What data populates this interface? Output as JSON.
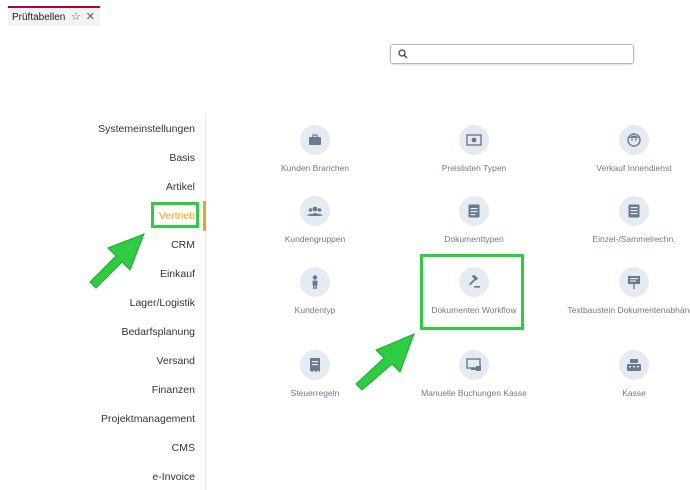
{
  "tab": {
    "title": "Prüftabellen",
    "star_icon": "star-icon",
    "close_icon": "close-icon"
  },
  "search": {
    "value": "",
    "placeholder": "",
    "icon": "search-icon"
  },
  "sidebar": {
    "items": [
      {
        "label": "Systemeinstellungen",
        "active": false
      },
      {
        "label": "Basis",
        "active": false
      },
      {
        "label": "Artikel",
        "active": false
      },
      {
        "label": "Vertrieb",
        "active": true
      },
      {
        "label": "CRM",
        "active": false
      },
      {
        "label": "Einkauf",
        "active": false
      },
      {
        "label": "Lager/Logistik",
        "active": false
      },
      {
        "label": "Bedarfsplanung",
        "active": false
      },
      {
        "label": "Versand",
        "active": false
      },
      {
        "label": "Finanzen",
        "active": false
      },
      {
        "label": "Projektmanagement",
        "active": false
      },
      {
        "label": "CMS",
        "active": false
      },
      {
        "label": "e-Invoice",
        "active": false
      }
    ]
  },
  "tiles": [
    {
      "label": "Kunden Branchen",
      "icon": "briefcase-icon"
    },
    {
      "label": "Preislisten Typen",
      "icon": "money-icon"
    },
    {
      "label": "Verkauf Innendienst",
      "icon": "face-icon"
    },
    {
      "label": "Kundengruppen",
      "icon": "group-icon"
    },
    {
      "label": "Dokumenttypen",
      "icon": "document-icon"
    },
    {
      "label": "Einzel-/Sammelrechn.",
      "icon": "list-document-icon"
    },
    {
      "label": "Kundentyp",
      "icon": "person-icon"
    },
    {
      "label": "Dokumenten Workflow",
      "icon": "gavel-icon"
    },
    {
      "label": "Textbaustein Dokumentenabhängig",
      "icon": "sign-icon"
    },
    {
      "label": "Steuerregeln",
      "icon": "receipt-icon"
    },
    {
      "label": "Manuelle Buchungen Kasse",
      "icon": "monitor-lock-icon"
    },
    {
      "label": "Kasse",
      "icon": "cash-register-icon"
    }
  ],
  "colors": {
    "accent": "#f0a020",
    "tab_border": "#b0003a",
    "highlight": "#2ecc40",
    "icon": "#6c7a8e",
    "icon_bg": "#e6ebf1"
  }
}
